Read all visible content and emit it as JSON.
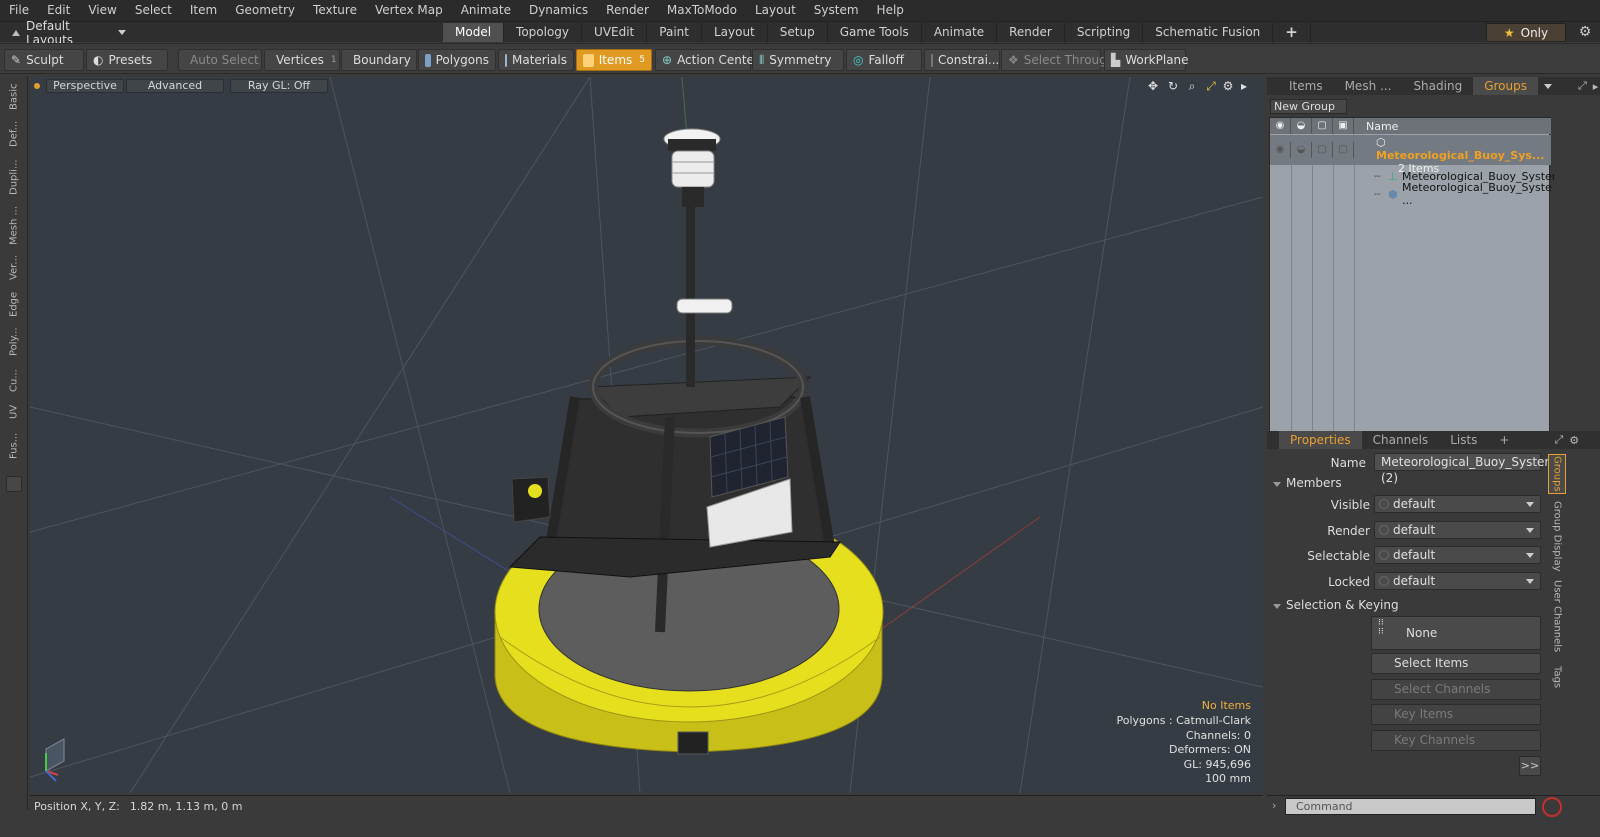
{
  "menu": [
    "File",
    "Edit",
    "View",
    "Select",
    "Item",
    "Geometry",
    "Texture",
    "Vertex Map",
    "Animate",
    "Dynamics",
    "Render",
    "MaxToModo",
    "Layout",
    "System",
    "Help"
  ],
  "layout": {
    "label": "Default Layouts"
  },
  "layout_tabs": [
    "Model",
    "Topology",
    "UVEdit",
    "Paint",
    "Layout",
    "Setup",
    "Game Tools",
    "Animate",
    "Render",
    "Scripting",
    "Schematic Fusion"
  ],
  "active_layout_tab": "Model",
  "only_label": "Only",
  "toolbar": {
    "sculpt": "Sculpt",
    "presets": "Presets",
    "auto_select": "Auto Select",
    "vertices": "Vertices",
    "vertices_count": "1",
    "boundary": "Boundary",
    "polygons": "Polygons",
    "materials": "Materials",
    "items": "Items",
    "items_count": "5",
    "action_center": "Action Center",
    "symmetry": "Symmetry",
    "falloff": "Falloff",
    "constrain": "Constrai...",
    "select_through": "Select Through",
    "workplane": "WorkPlane"
  },
  "left_tabs": [
    "Basic",
    "Def...",
    "Dupli...",
    "Mesh ...",
    "Ver...",
    "Edge",
    "Poly...",
    "Cu...",
    "UV",
    "Fus..."
  ],
  "viewport": {
    "perspective": "Perspective",
    "advanced": "Advanced",
    "raygl": "Ray GL: Off",
    "info": {
      "no_items": "No Items",
      "polygons": "Polygons : Catmull-Clark",
      "channels": "Channels: 0",
      "deformers": "Deformers: ON",
      "gl": "GL: 945,696",
      "scale": "100 mm"
    }
  },
  "status": {
    "position_label": "Position X, Y, Z:",
    "position_value": "1.82 m, 1.13 m, 0 m"
  },
  "right_top_tabs": [
    "Items",
    "Mesh ...",
    "Shading",
    "Groups"
  ],
  "active_right_tab": "Groups",
  "new_group": "New Group",
  "groups": {
    "name_header": "Name",
    "root": {
      "name": "Meteorological_Buoy_Sys...",
      "count": "2 Items"
    },
    "children": [
      "Meteorological_Buoy_System",
      "Meteorological_Buoy_Syste ..."
    ]
  },
  "prop_tabs": [
    "Properties",
    "Channels",
    "Lists",
    "+"
  ],
  "properties": {
    "name_label": "Name",
    "name_value": "Meteorological_Buoy_System (2)",
    "members": "Members",
    "visible_label": "Visible",
    "visible": "default",
    "render_label": "Render",
    "render": "default",
    "selectable_label": "Selectable",
    "selectable": "default",
    "locked_label": "Locked",
    "locked": "default",
    "selection_keying": "Selection & Keying",
    "none": "None",
    "select_items": "Select Items",
    "select_channels": "Select Channels",
    "key_items": "Key Items",
    "key_channels": "Key Channels",
    "more": ">>"
  },
  "side_tabs": [
    "Groups",
    "Group Display",
    "User Channels",
    "Tags"
  ],
  "command": {
    "placeholder": "Command"
  },
  "colors": {
    "accent": "#e09a22",
    "viewport_bg": "#363c44",
    "buoy_yellow": "#e6df1e"
  }
}
